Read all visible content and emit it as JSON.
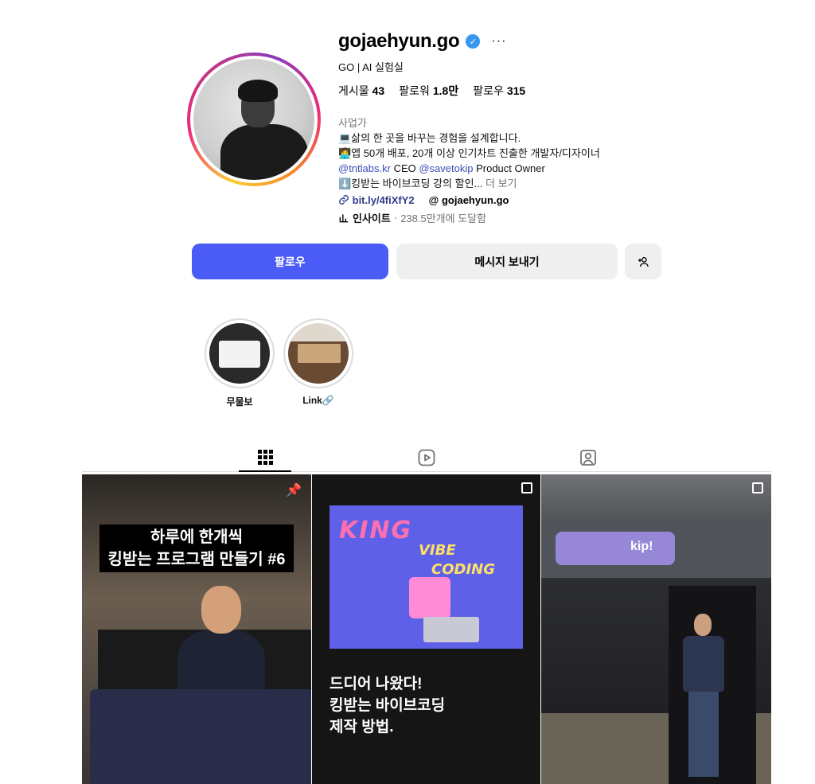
{
  "profile": {
    "username": "gojaehyun.go",
    "verified_mark": "✓",
    "more": "···",
    "fullname": "GO | AI 실험실",
    "stats": {
      "posts_label": "게시물",
      "posts_value": "43",
      "followers_label": "팔로워",
      "followers_value": "1.8만",
      "following_label": "팔로우",
      "following_value": "315"
    },
    "category": "사업가",
    "bio": {
      "line1": "💻삶의 한 곳을 바꾸는 경험을 설계합니다.",
      "line2": "🧑‍💻앱 50개 배포, 20개 이상 인기차트 진출한 개발자/디자이너",
      "mention1": "@tntlabs.kr",
      "ceo": " CEO ",
      "mention2": "@savetokip",
      "po": " Product Owner",
      "line4": "⬇️킹받는 바이브코딩 강의 할인...",
      "more": " 더 보기"
    },
    "link_url": "bit.ly/4fiXfY2",
    "threads_handle": "gojaehyun.go",
    "insight_label": "인사이트",
    "insight_dot": " · ",
    "insight_value": "238.5만개에 도달함"
  },
  "actions": {
    "follow": "팔로우",
    "message": "메시지 보내기",
    "add_user": "+👤"
  },
  "highlights": [
    {
      "label": "무물보"
    },
    {
      "label": "Link🔗"
    }
  ],
  "posts": {
    "p1_line1": "하루에 한개씩",
    "p1_line2": "킹받는 프로그램 만들기 #6",
    "p2_king": "KING",
    "p2_vibe": "VIBE",
    "p2_coding": "CODING",
    "p2_caption1": "드디어 나왔다!",
    "p2_caption2": "킹받는 바이브코딩",
    "p2_caption3": "제작 방법.",
    "p3_sign": "kip!"
  }
}
